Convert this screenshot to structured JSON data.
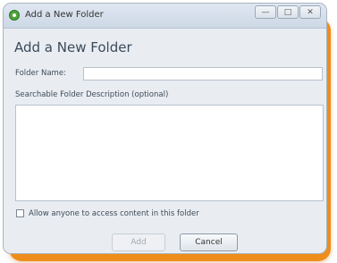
{
  "window": {
    "title": "Add a New Folder",
    "controls": [
      "—",
      "□",
      "✕"
    ]
  },
  "dialog": {
    "heading": "Add a New Folder",
    "folder_name_label": "Folder Name:",
    "folder_name_value": "",
    "description_label": "Searchable Folder Description (optional)",
    "description_value": "",
    "checkbox_label": "Allow anyone to access content in this folder",
    "checkbox_checked": false,
    "add_label": "Add",
    "cancel_label": "Cancel"
  },
  "colors": {
    "accent_frame": "#ef8d1a",
    "app_icon": "#4fa33b"
  }
}
